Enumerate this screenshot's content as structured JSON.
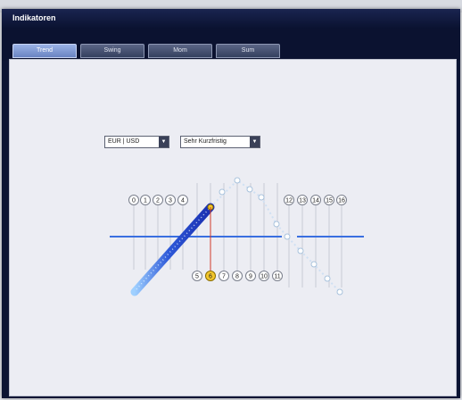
{
  "window": {
    "title": "Indikatoren"
  },
  "tabs": [
    {
      "label": "Trend",
      "active": true
    },
    {
      "label": "Swing",
      "active": false
    },
    {
      "label": "Mom",
      "active": false
    },
    {
      "label": "Sum",
      "active": false
    }
  ],
  "controls": {
    "pair_select": {
      "value": "EUR | USD"
    },
    "timeframe_select": {
      "value": "Sehr Kurzfristig"
    }
  },
  "nodes": {
    "top_left": [
      "0",
      "1",
      "2",
      "3",
      "4"
    ],
    "bottom": [
      "5",
      "6",
      "7",
      "8",
      "9",
      "10",
      "11"
    ],
    "top_right": [
      "12",
      "13",
      "14",
      "15",
      "16"
    ],
    "selected": "6"
  },
  "colors": {
    "title_bar": "#0c1433",
    "tab_active": "#8aa2da",
    "baseline": "#3a6fe0",
    "trend_line": "#1a2fb0",
    "selected_node": "#f2c62c"
  }
}
